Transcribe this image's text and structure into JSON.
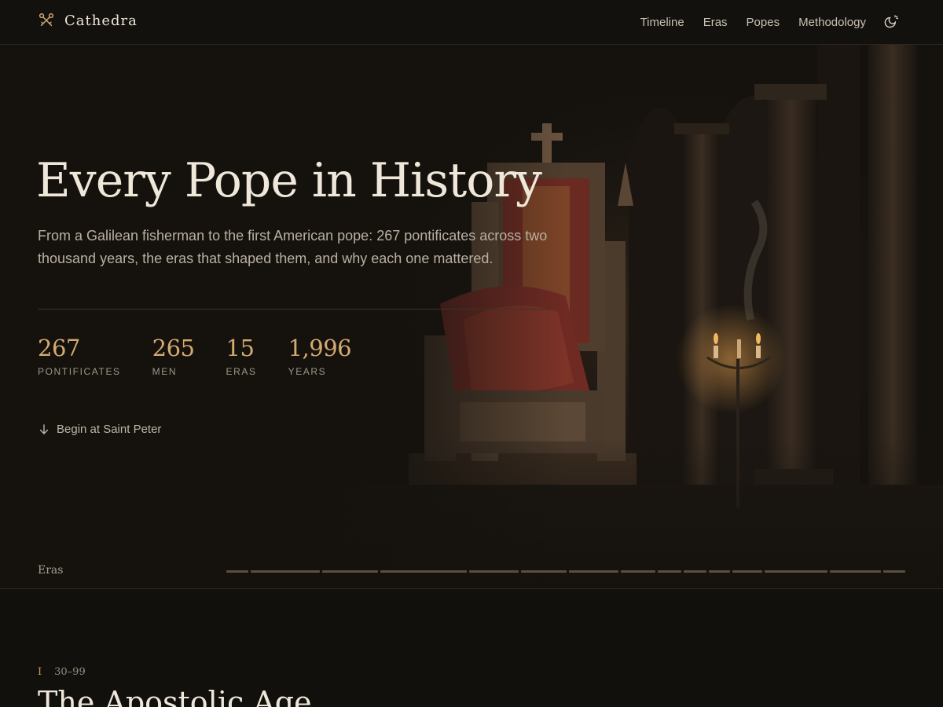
{
  "brand": {
    "name": "Cathedra",
    "icon": "crossed-keys-icon"
  },
  "nav": {
    "links": [
      "Timeline",
      "Eras",
      "Popes",
      "Methodology"
    ],
    "theme_toggle_icon": "theme-toggle-icon"
  },
  "hero": {
    "title": "Every Pope in History",
    "subtitle": "From a Galilean fisherman to the first American pope: 267 pontificates across two thousand years, the eras that shaped them, and why each one mattered.",
    "stats": [
      {
        "value": "267",
        "label": "PONTIFICATES"
      },
      {
        "value": "265",
        "label": "MEN"
      },
      {
        "value": "15",
        "label": "ERAS"
      },
      {
        "value": "1,996",
        "label": "YEARS"
      }
    ],
    "begin_link": "Begin at Saint Peter"
  },
  "eras_bar": {
    "label": "Eras",
    "segment_count": 15
  },
  "era_section": {
    "numeral": "I",
    "years": "30–99",
    "title": "The Apostolic Age"
  },
  "colors": {
    "background": "#12100d",
    "accent_gold": "#d4aa71",
    "text": "#efe8da",
    "muted": "#9e9687"
  }
}
